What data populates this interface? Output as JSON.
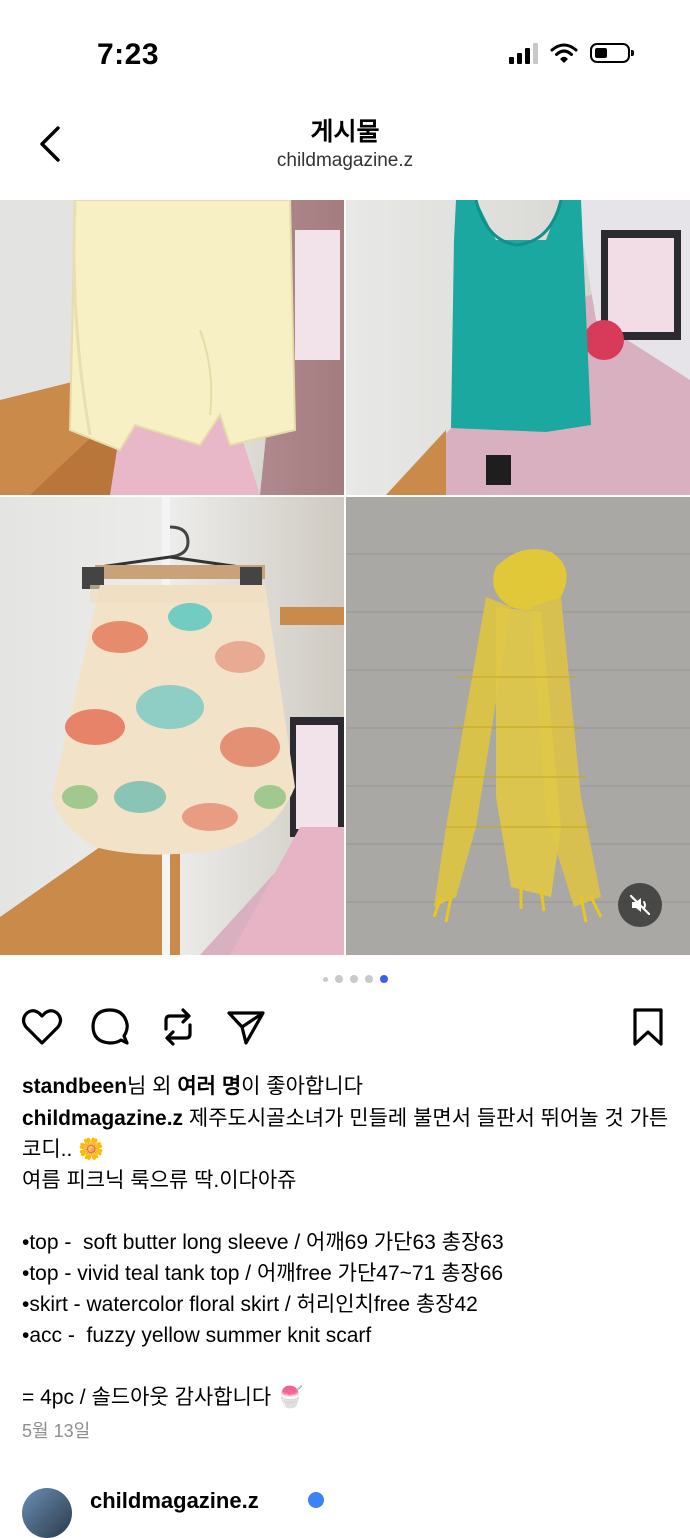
{
  "status_bar": {
    "time": "7:23"
  },
  "header": {
    "title": "게시물",
    "subtitle": "childmagazine.z"
  },
  "carousel": {
    "total": 5,
    "active_index": 4
  },
  "likes": {
    "user": "standbeen",
    "mid": "님 외 ",
    "bold": "여러 명",
    "tail": "이 좋아합니다"
  },
  "caption": {
    "author": "childmagazine.z",
    "text": " 제주도시골소녀가 민들레 불면서 들판서 뛰어놀 것 가튼 코디.. 🌼\n여름 피크닉 룩으류 딱.이다아쥬\n\n•top -  soft butter long sleeve / 어깨69 가단63 총장63\n•top - vivid teal tank top / 어깨free 가단47~71 총장66\n•skirt - watercolor floral skirt / 허리인치free 총장42\n•acc -  fuzzy yellow summer knit scarf\n\n= 4pc / 솔드아웃 감사합니다 🍧"
  },
  "date": "5월 13일",
  "next_post": {
    "username": "childmagazine.z"
  },
  "icons": {
    "back": "chevron-left-icon",
    "like": "heart-icon",
    "comment": "comment-icon",
    "repost": "repost-icon",
    "share": "send-icon",
    "save": "bookmark-icon",
    "mute": "speaker-muted-icon"
  },
  "colors": {
    "accent_dot": "#3b5cf5",
    "muted_text": "#8e8e8e"
  }
}
